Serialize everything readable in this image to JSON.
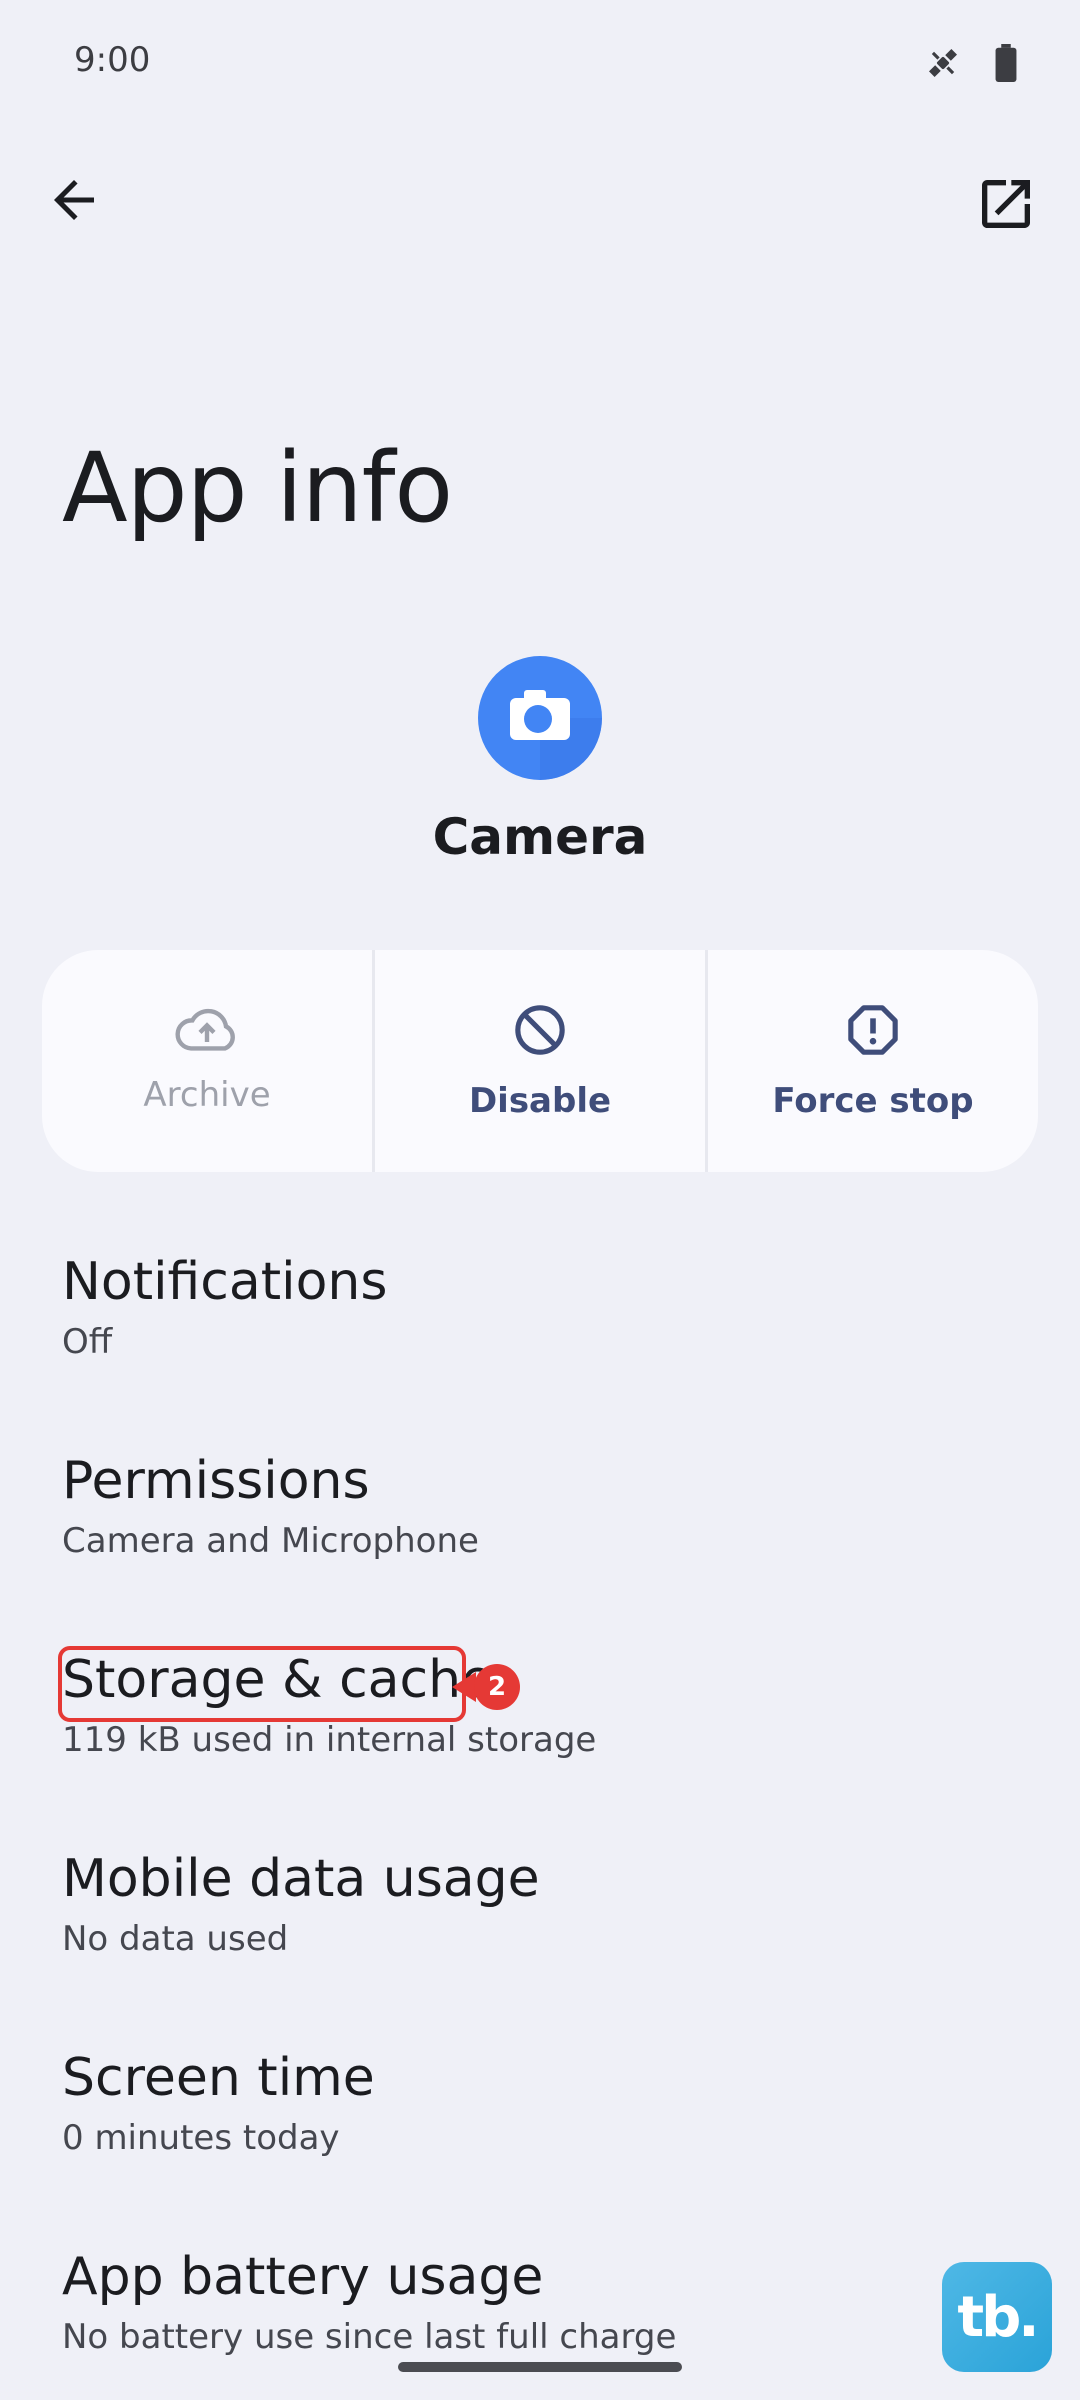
{
  "status_bar": {
    "time": "9:00",
    "icons": [
      "satellite-icon",
      "battery-icon"
    ]
  },
  "top_bar": {
    "back_icon": "arrow-back-icon",
    "open_icon": "open-in-new-icon"
  },
  "page": {
    "title": "App info"
  },
  "app": {
    "name": "Camera",
    "icon": "camera-app-icon",
    "icon_color": "#4285f4"
  },
  "actions": [
    {
      "label": "Archive",
      "icon": "cloud-upload-icon",
      "enabled": false
    },
    {
      "label": "Disable",
      "icon": "block-icon",
      "enabled": true
    },
    {
      "label": "Force stop",
      "icon": "error-icon",
      "enabled": true
    }
  ],
  "settings": [
    {
      "title": "Notifications",
      "subtitle": "Off"
    },
    {
      "title": "Permissions",
      "subtitle": "Camera and Microphone"
    },
    {
      "title": "Storage & cache",
      "subtitle": "119 kB used in internal storage"
    },
    {
      "title": "Mobile data usage",
      "subtitle": "No data used"
    },
    {
      "title": "Screen time",
      "subtitle": "0 minutes today"
    },
    {
      "title": "App battery usage",
      "subtitle": "No battery use since last full charge"
    }
  ],
  "annotation": {
    "marker_number": "2",
    "highlight_color": "#e53935"
  },
  "watermark": {
    "text": "tb."
  },
  "colors": {
    "background": "#eff0f7",
    "action_text": "#3f4d7a",
    "action_disabled": "#9ea1ab"
  }
}
